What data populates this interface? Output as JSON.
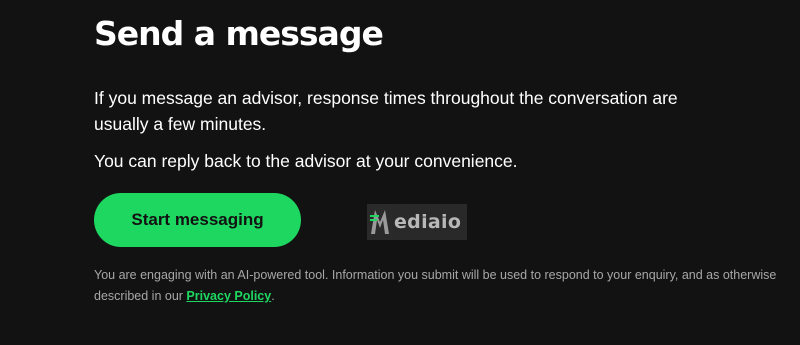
{
  "page": {
    "title": "Send a message",
    "paragraph_1": "If you message an advisor, response times throughout the conversation are usually a few minutes.",
    "paragraph_2": "You can reply back to the advisor at your convenience.",
    "start_button_label": "Start messaging",
    "disclaimer_prefix": "You are engaging with an AI-powered tool. Information you submit will be used to respond to your enquiry, and as otherwise described in our ",
    "privacy_link_label": "Privacy Policy",
    "disclaimer_suffix": "."
  },
  "watermark": {
    "text": "ediaio",
    "icon": "mediaio-logo-icon"
  },
  "colors": {
    "background": "#121212",
    "accent": "#1ed760",
    "muted_text": "#a7a7a7"
  }
}
